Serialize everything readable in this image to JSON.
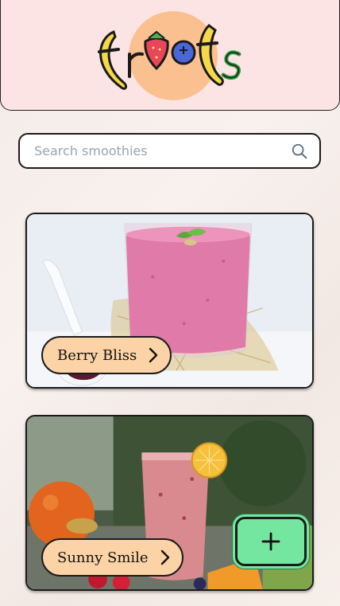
{
  "app": {
    "logo_text": "froots"
  },
  "search": {
    "placeholder": "Search smoothies",
    "value": ""
  },
  "smoothies": [
    {
      "name": "Berry Bliss"
    },
    {
      "name": "Sunny Smile"
    }
  ],
  "actions": {
    "add_label": "+"
  },
  "colors": {
    "header_bg": "#fde4e4",
    "pill_bg": "#fcd3a6",
    "add_button": "#74e6a0",
    "border": "#1b1b1b"
  },
  "icons": [
    "search-icon",
    "chevron-right-icon",
    "plus-icon"
  ]
}
